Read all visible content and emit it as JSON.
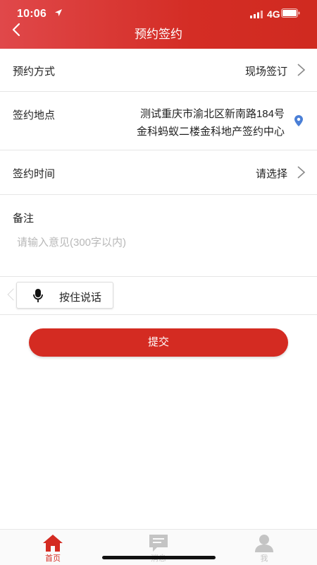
{
  "status_bar": {
    "time": "10:06",
    "network": "4G"
  },
  "nav": {
    "title": "预约签约"
  },
  "form": {
    "method": {
      "label": "预约方式",
      "value": "现场签订"
    },
    "location": {
      "label": "签约地点",
      "line1": "测试重庆市渝北区新南路184号",
      "line2": "金科蚂蚁二楼金科地产签约中心"
    },
    "time": {
      "label": "签约时间",
      "value": "请选择"
    },
    "remark": {
      "label": "备注",
      "placeholder": "请输入意见(300字以内)"
    }
  },
  "voice_button": {
    "label": "按住说话"
  },
  "submit_button": {
    "label": "提交"
  },
  "tabbar": {
    "items": [
      {
        "label": "首页",
        "icon": "home-icon",
        "active": true
      },
      {
        "label": "消息",
        "icon": "message-icon",
        "active": false
      },
      {
        "label": "我",
        "icon": "user-icon",
        "active": false
      }
    ]
  },
  "colors": {
    "brand": "#d42b22",
    "location_pin": "#4a7fd6",
    "tab_inactive": "#c4c4c4"
  }
}
